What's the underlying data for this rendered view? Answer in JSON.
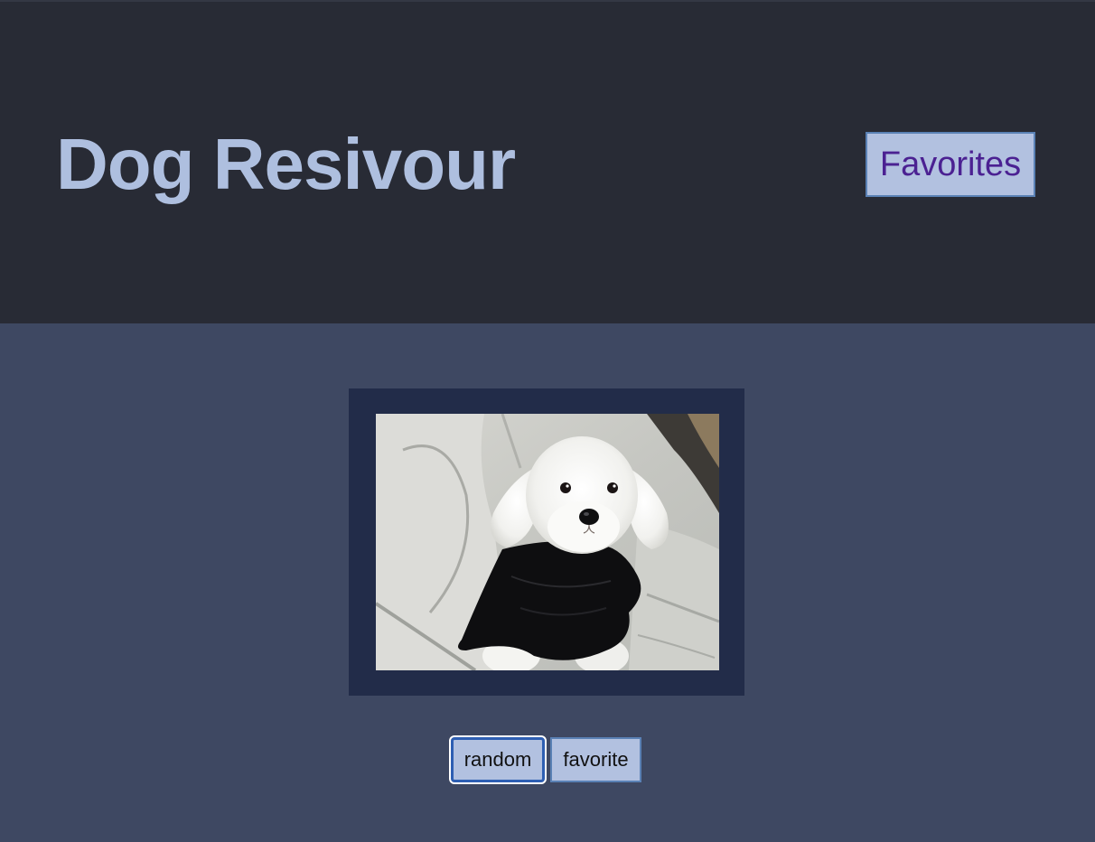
{
  "header": {
    "title": "Dog Resivour",
    "favorites_label": "Favorites"
  },
  "photo": {
    "alt": "white maltese dog wearing a black sweater"
  },
  "actions": {
    "random_label": "random",
    "favorite_label": "favorite"
  },
  "colors": {
    "header_bg": "#282b35",
    "main_bg": "#3e4862",
    "frame_bg": "#222c49",
    "title": "#aebfdf",
    "button_bg": "#b2c1e0",
    "button_border": "#5a81b5",
    "link_text": "#4b2192"
  }
}
